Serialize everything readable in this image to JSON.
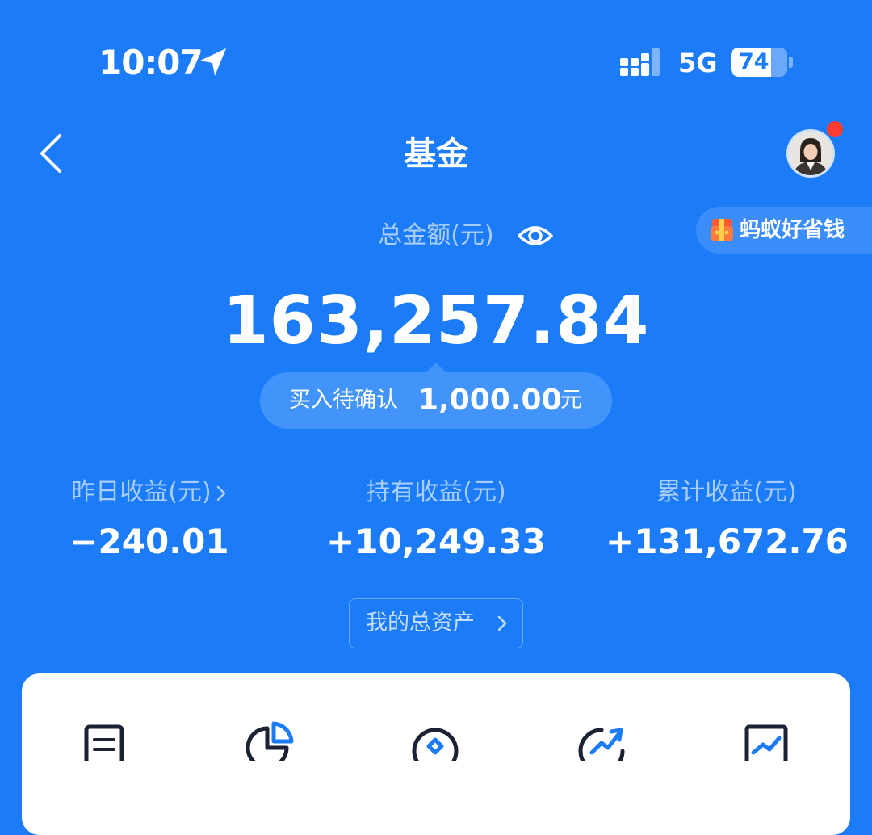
{
  "status_bar": {
    "time": "10:07",
    "network": "5G",
    "battery": "74"
  },
  "header": {
    "title": "基金"
  },
  "promo": {
    "label": "蚂蚁好省钱"
  },
  "summary": {
    "total_label": "总金额(元)",
    "total_amount": "163,257.84",
    "pending_label": "买入待确认",
    "pending_amount": "1,000.00",
    "pending_unit": "元"
  },
  "stats": [
    {
      "label": "昨日收益(元)",
      "value": "−240.01"
    },
    {
      "label": "持有收益(元)",
      "value": "+10,249.33"
    },
    {
      "label": "累计收益(元)",
      "value": "+131,672.76"
    }
  ],
  "assets_button": {
    "label": "我的总资产"
  },
  "colors": {
    "background": "#1c7cf8",
    "label_text": "#a9cdfc",
    "pill": "#4294fa",
    "notification_dot": "#ff3b30",
    "card": "#ffffff"
  },
  "icons": {
    "location": "location-arrow-icon",
    "signal": "signal-bars-icon",
    "back": "chevron-left-icon",
    "eye": "eye-icon",
    "avatar": "user-avatar",
    "promo": "gift-icon",
    "card_icons": [
      "document-icon",
      "pie-chart-icon",
      "badge-icon",
      "trend-up-icon",
      "line-chart-icon"
    ]
  }
}
